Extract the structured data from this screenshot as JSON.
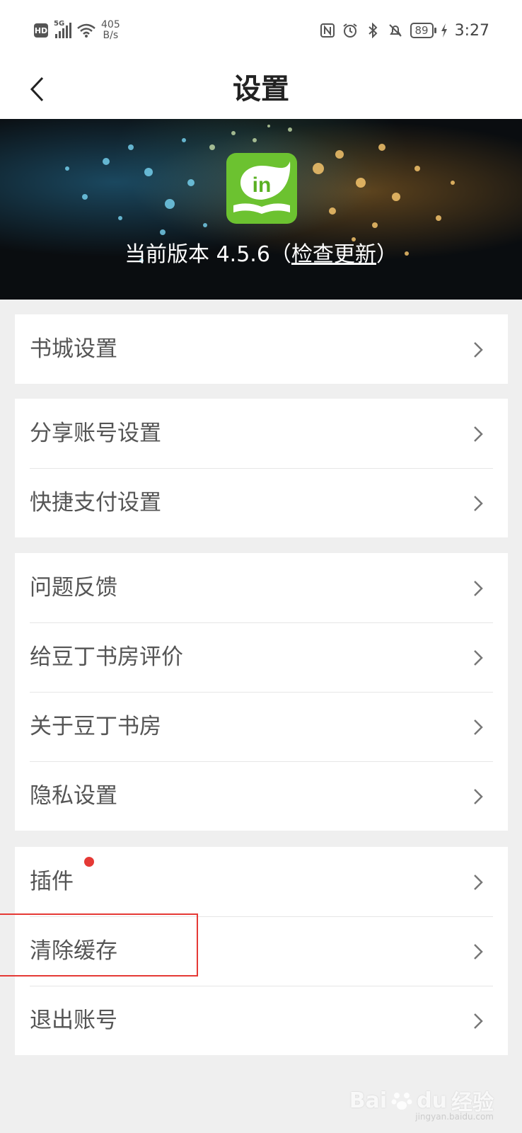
{
  "status_bar": {
    "hd": "HD",
    "network": "5G",
    "speed_value": "405",
    "speed_unit": "B/s",
    "battery": "89",
    "time": "3:27"
  },
  "header": {
    "title": "设置"
  },
  "banner": {
    "version_prefix": "当前版本 4.5.6（",
    "check_update": "检查更新",
    "version_suffix": "）",
    "logo_text": "in"
  },
  "groups": [
    {
      "items": [
        {
          "label": "书城设置"
        }
      ]
    },
    {
      "items": [
        {
          "label": "分享账号设置"
        },
        {
          "label": "快捷支付设置"
        }
      ]
    },
    {
      "items": [
        {
          "label": "问题反馈"
        },
        {
          "label": "给豆丁书房评价"
        },
        {
          "label": "关于豆丁书房"
        },
        {
          "label": "隐私设置"
        }
      ]
    },
    {
      "items": [
        {
          "label": "插件"
        },
        {
          "label": "清除缓存"
        },
        {
          "label": "退出账号"
        }
      ]
    }
  ],
  "watermark": {
    "brand": "Bai",
    "brand2": "du",
    "suffix": "经验",
    "url": "jingyan.baidu.com"
  },
  "colors": {
    "accent_red": "#e53935",
    "logo_green": "#6cc230"
  }
}
